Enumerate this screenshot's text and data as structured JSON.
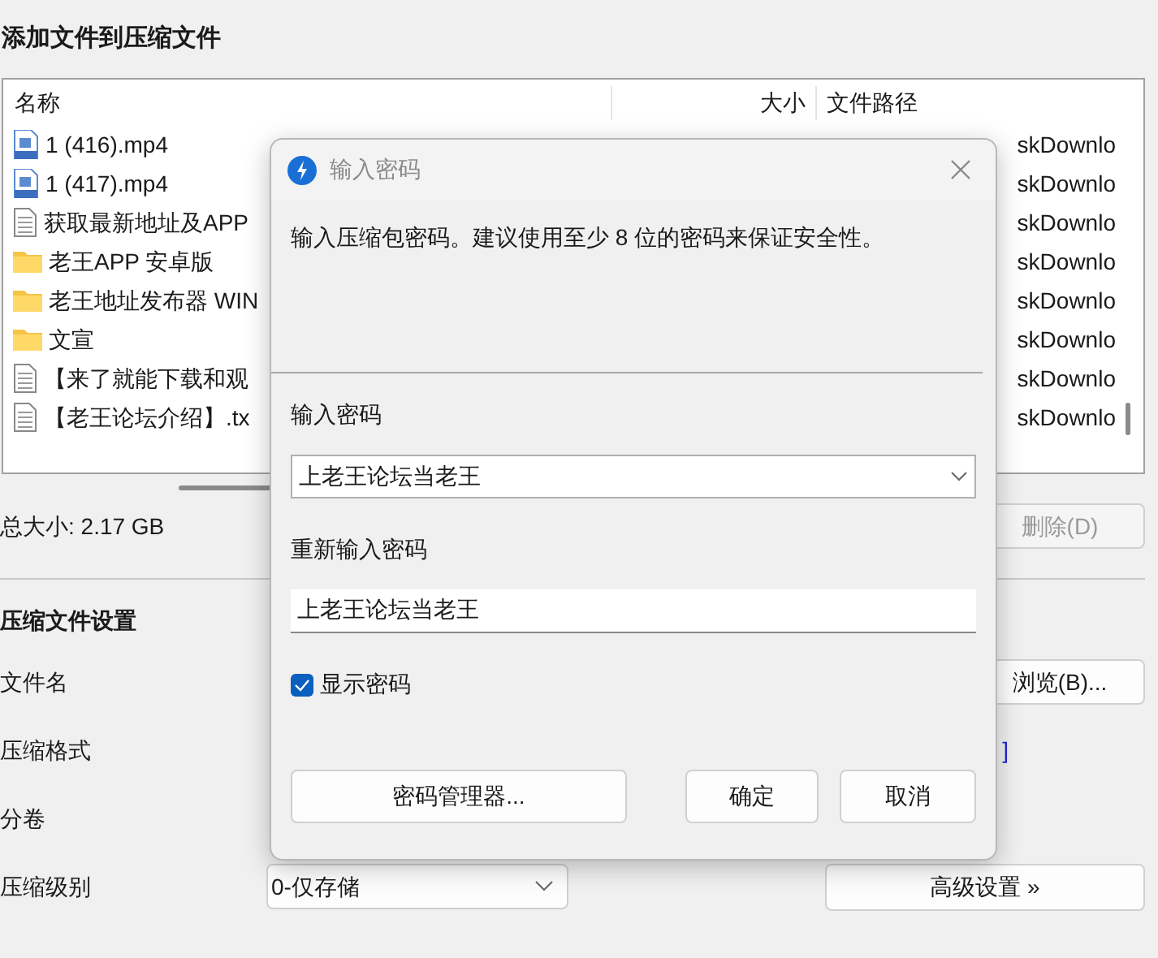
{
  "window": {
    "title": "添加文件到压缩文件"
  },
  "file_list": {
    "columns": [
      "名称",
      "大小",
      "文件路径"
    ],
    "rows": [
      {
        "kind": "video",
        "name": "1 (416).mp4",
        "path": "skDownlo"
      },
      {
        "kind": "video",
        "name": "1 (417).mp4",
        "path": "skDownlo"
      },
      {
        "kind": "text",
        "name": "获取最新地址及APP",
        "path": "skDownlo"
      },
      {
        "kind": "folder",
        "name": "老王APP 安卓版",
        "path": "skDownlo"
      },
      {
        "kind": "folder",
        "name": "老王地址发布器 WIN",
        "path": "skDownlo"
      },
      {
        "kind": "folder",
        "name": "文宣",
        "path": "skDownlo"
      },
      {
        "kind": "text",
        "name": "【来了就能下载和观",
        "path": "skDownlo"
      },
      {
        "kind": "text",
        "name": "【老王论坛介绍】.tx",
        "path": "skDownlo"
      }
    ]
  },
  "total_size": "总大小: 2.17 GB",
  "delete_button": {
    "label": "删除(D)",
    "disabled": true
  },
  "settings": {
    "title": "压缩文件设置",
    "file_name_label": "文件名",
    "browse_button": "浏览(B)...",
    "format_label": "压缩格式",
    "format_link": "]",
    "volume_label": "分卷",
    "level_label": "压缩级别",
    "level_value": "0-仅存储",
    "advanced_button": "高级设置 »"
  },
  "dialog": {
    "title": "输入密码",
    "message": "输入压缩包密码。建议使用至少 8 位的密码来保证安全性。",
    "password_label": "输入密码",
    "password_value": "上老王论坛当老王",
    "confirm_label": "重新输入密码",
    "confirm_value": "上老王论坛当老王",
    "show_password": {
      "label": "显示密码",
      "checked": true
    },
    "manager_button": "密码管理器...",
    "ok_button": "确定",
    "cancel_button": "取消"
  }
}
